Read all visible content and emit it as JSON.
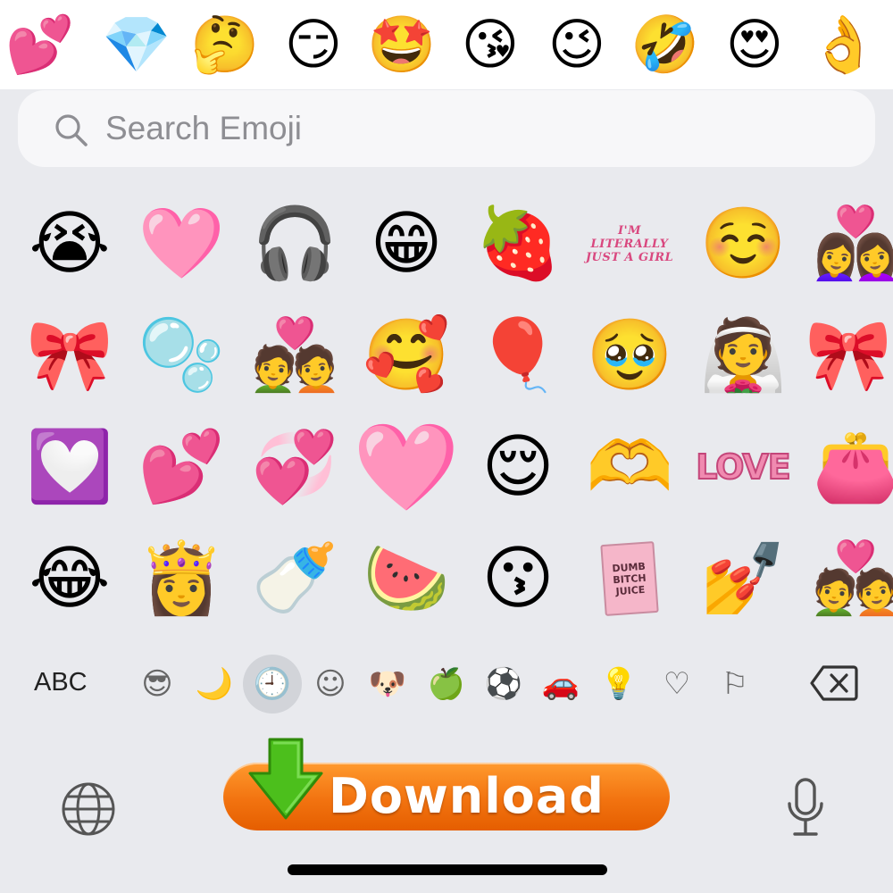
{
  "top_emojis": [
    "💕",
    "💎",
    "🤔",
    "😏",
    "🤩",
    "😘",
    "😉",
    "🤣",
    "😍",
    "👌"
  ],
  "search": {
    "placeholder": "Search Emoji"
  },
  "grid": {
    "rows": [
      [
        "😭",
        "🩷",
        "🎧",
        "😁",
        "🍓",
        "I'M LITERALLY JUST A GIRL",
        "☺️",
        "👩‍❤️‍👩"
      ],
      [
        "🎀",
        "🫧",
        "💑",
        "🥰",
        "🎈",
        "🥹",
        "👰",
        "🎀"
      ],
      [
        "💟",
        "💕",
        "💞",
        "🩷",
        "😌",
        "🫶",
        "LOVE",
        "👛"
      ],
      [
        "😂",
        "👸",
        "🍼",
        "🍉",
        "😗",
        "DUMB BITCH JUICE",
        "💅",
        "💑"
      ]
    ]
  },
  "category_bar": {
    "abc_label": "ABC",
    "categories": [
      "😎",
      "🌙",
      "🕘",
      "☺",
      "🐶",
      "🍏",
      "⚽",
      "🚗",
      "💡",
      "♡",
      "⚐"
    ],
    "active_index": 2
  },
  "download_button": {
    "label": "Download"
  },
  "colors": {
    "keyboard_bg": "#e9eaee",
    "download_orange": "#f27310",
    "arrow_green": "#4cbf1c"
  }
}
